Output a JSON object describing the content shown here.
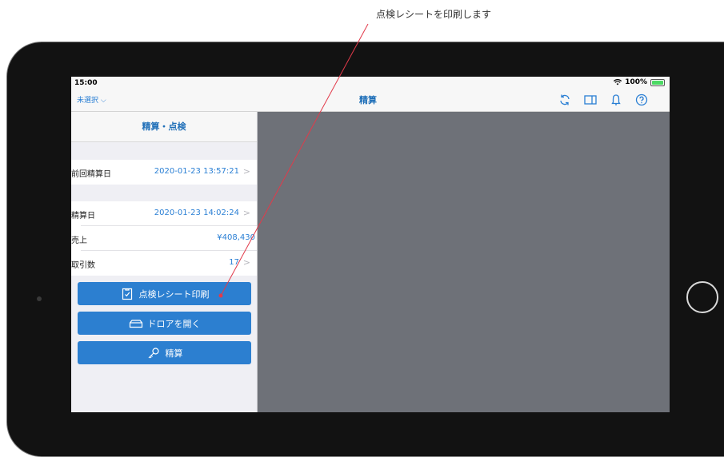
{
  "annotation": "点検レシートを印刷します",
  "status_bar": {
    "time": "15:00",
    "battery": "100%"
  },
  "nav": {
    "back_label": "未選択",
    "title": "精算"
  },
  "panel": {
    "title": "精算・点検",
    "rows": [
      {
        "label": "前回精算日",
        "value": "2020-01-23 13:57:21"
      },
      {
        "label": "精算日",
        "value": "2020-01-23 14:02:24"
      },
      {
        "label": "売上",
        "value": "¥408,430"
      },
      {
        "label": "取引数",
        "value": "17"
      }
    ],
    "buttons": [
      {
        "label": "点検レシート印刷",
        "icon": "checklist-icon"
      },
      {
        "label": "ドロアを開く",
        "icon": "drawer-icon"
      },
      {
        "label": "精算",
        "icon": "key-icon"
      }
    ]
  },
  "colors": {
    "accent": "#2c7fd0",
    "detail_bg": "#6e7178",
    "pointer": "#e23a4a"
  }
}
